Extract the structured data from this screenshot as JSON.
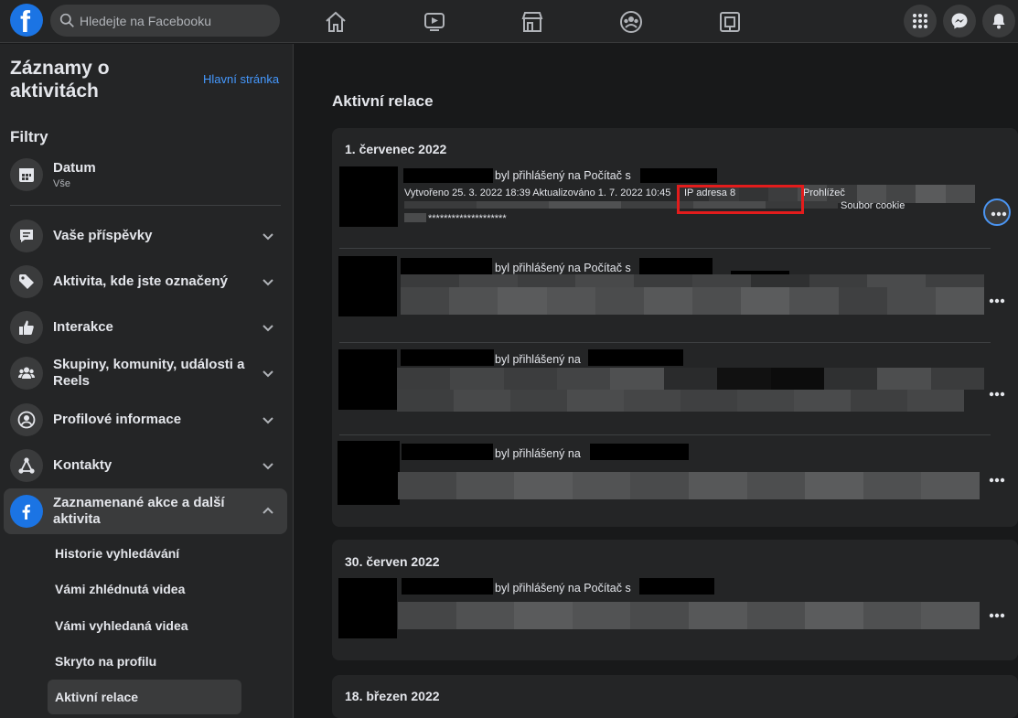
{
  "topbar": {
    "logo_letter": "f",
    "search_placeholder": "Hledejte na Facebooku",
    "nav_icons": [
      "home-icon",
      "watch-icon",
      "marketplace-icon",
      "groups-icon",
      "gaming-icon"
    ],
    "right_icons": [
      "menu-grid-icon",
      "messenger-icon",
      "notifications-icon"
    ]
  },
  "sidebar": {
    "title": "Záznamy o aktivitách",
    "home_link": "Hlavní stránka",
    "filters_label": "Filtry",
    "date_filter": {
      "label": "Datum",
      "value": "Vše",
      "icon": "calendar-icon"
    },
    "items": [
      {
        "label": "Vaše příspěvky",
        "icon": "posts-icon"
      },
      {
        "label": "Aktivita, kde jste označený",
        "icon": "tag-icon"
      },
      {
        "label": "Interakce",
        "icon": "like-icon"
      },
      {
        "label": "Skupiny, komunity, události a Reels",
        "icon": "groups-icon"
      },
      {
        "label": "Profilové informace",
        "icon": "profile-icon"
      },
      {
        "label": "Kontakty",
        "icon": "connections-icon"
      },
      {
        "label": "Zaznamenané akce a další aktivita",
        "icon": "facebook-icon"
      }
    ],
    "sub_items": [
      "Historie vyhledávání",
      "Vámi zhlédnutá videa",
      "Vámi vyhledaná videa",
      "Skryto na profilu",
      "Aktivní relace"
    ]
  },
  "main": {
    "title": "Aktivní relace",
    "groups": [
      {
        "date": "1. červenec 2022",
        "sessions": [
          {
            "line1": "byl přihlášený na Počítač s",
            "detail": "Vytvořeno 25. 3. 2022 18:39 Aktualizováno 1. 7. 2022 10:45",
            "ip_label": "IP adresa 8",
            "browser_label": "Prohlížeč",
            "cookie_label": "Soubor cookie",
            "masked": "********************"
          },
          {
            "line1": "byl přihlášený na Počítač s"
          },
          {
            "line1": "byl přihlášený na"
          },
          {
            "line1": "byl přihlášený na"
          }
        ]
      },
      {
        "date": "30. červen 2022",
        "sessions": [
          {
            "line1": "byl přihlášený na Počítač s"
          }
        ]
      },
      {
        "date": "18. březen 2022",
        "sessions": []
      }
    ]
  },
  "colors": {
    "accent": "#1b74e4",
    "link": "#4599ff",
    "highlight": "#e31c1c"
  }
}
